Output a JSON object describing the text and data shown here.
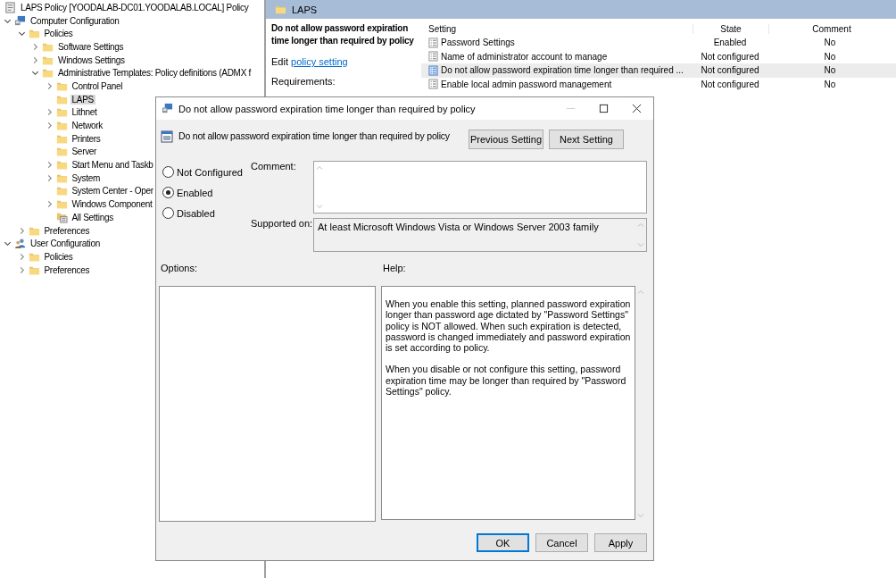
{
  "tree": {
    "title": "LAPS Policy [YOODALAB-DC01.YOODALAB.LOCAL] Policy",
    "items": [
      {
        "label": "Computer Configuration",
        "kind": "computer",
        "expanded": true,
        "selected": false,
        "children": [
          {
            "label": "Policies",
            "kind": "folder",
            "expanded": true,
            "selected": false,
            "children": [
              {
                "label": "Software Settings",
                "kind": "folder",
                "expanded": false,
                "selected": false
              },
              {
                "label": "Windows Settings",
                "kind": "folder",
                "expanded": false,
                "selected": false
              },
              {
                "label": "Administrative Templates: Policy definitions (ADMX f",
                "kind": "folder",
                "expanded": true,
                "selected": false,
                "children": [
                  {
                    "label": "Control Panel",
                    "kind": "folder",
                    "expanded": false,
                    "selected": false
                  },
                  {
                    "label": "LAPS",
                    "kind": "folder",
                    "selected": true
                  },
                  {
                    "label": "Lithnet",
                    "kind": "folder",
                    "expanded": false,
                    "selected": false
                  },
                  {
                    "label": "Network",
                    "kind": "folder",
                    "expanded": false,
                    "selected": false
                  },
                  {
                    "label": "Printers",
                    "kind": "folder",
                    "selected": false
                  },
                  {
                    "label": "Server",
                    "kind": "folder",
                    "selected": false
                  },
                  {
                    "label": "Start Menu and Taskb",
                    "kind": "folder",
                    "expanded": false,
                    "selected": false
                  },
                  {
                    "label": "System",
                    "kind": "folder",
                    "expanded": false,
                    "selected": false
                  },
                  {
                    "label": "System Center - Oper",
                    "kind": "folder",
                    "selected": false
                  },
                  {
                    "label": "Windows Component",
                    "kind": "folder",
                    "expanded": false,
                    "selected": false
                  },
                  {
                    "label": "All Settings",
                    "kind": "all-settings",
                    "selected": false
                  }
                ]
              }
            ]
          },
          {
            "label": "Preferences",
            "kind": "folder",
            "expanded": false,
            "selected": false
          }
        ]
      },
      {
        "label": "User Configuration",
        "kind": "user",
        "expanded": true,
        "selected": false,
        "children": [
          {
            "label": "Policies",
            "kind": "folder",
            "expanded": false,
            "selected": false
          },
          {
            "label": "Preferences",
            "kind": "folder",
            "expanded": false,
            "selected": false
          }
        ]
      }
    ]
  },
  "details": {
    "header": "LAPS",
    "title": "Do not allow password expiration time longer than required by policy",
    "edit_prefix": "Edit",
    "edit_link": "policy setting",
    "requirements_label": "Requirements:"
  },
  "table": {
    "columns": [
      "Setting",
      "State",
      "Comment"
    ],
    "rows": [
      {
        "setting": "Password Settings",
        "state": "Enabled",
        "comment": "No",
        "selected": false
      },
      {
        "setting": "Name of administrator account to manage",
        "state": "Not configured",
        "comment": "No",
        "selected": false
      },
      {
        "setting": "Do not allow password expiration time longer than required ...",
        "state": "Not configured",
        "comment": "No",
        "selected": true
      },
      {
        "setting": "Enable local admin password management",
        "state": "Not configured",
        "comment": "No",
        "selected": false
      }
    ]
  },
  "dialog": {
    "title": "Do not allow password expiration time longer than required by policy",
    "header_title": "Do not allow password expiration time longer than required by policy",
    "nav_buttons": [
      "Previous Setting",
      "Next Setting"
    ],
    "states": [
      {
        "label": "Not Configured",
        "selected": false
      },
      {
        "label": "Enabled",
        "selected": true
      },
      {
        "label": "Disabled",
        "selected": false
      }
    ],
    "comment_label": "Comment:",
    "supported_label": "Supported on:",
    "supported_text": "At least Microsoft Windows Vista or Windows Server 2003 family",
    "options_label": "Options:",
    "help_label": "Help:",
    "help_paragraphs": [
      "When you enable this setting, planned password expiration longer than password age dictated by \"Password Settings\" policy is NOT allowed. When such expiration is detected, password is changed immediately and password expiration is set according to policy.",
      "When you disable or not configure this setting, password expiration time may be longer than required by \"Password Settings\" policy."
    ],
    "buttons": [
      {
        "label": "OK",
        "default": true
      },
      {
        "label": "Cancel",
        "default": false
      },
      {
        "label": "Apply",
        "default": false
      }
    ]
  }
}
